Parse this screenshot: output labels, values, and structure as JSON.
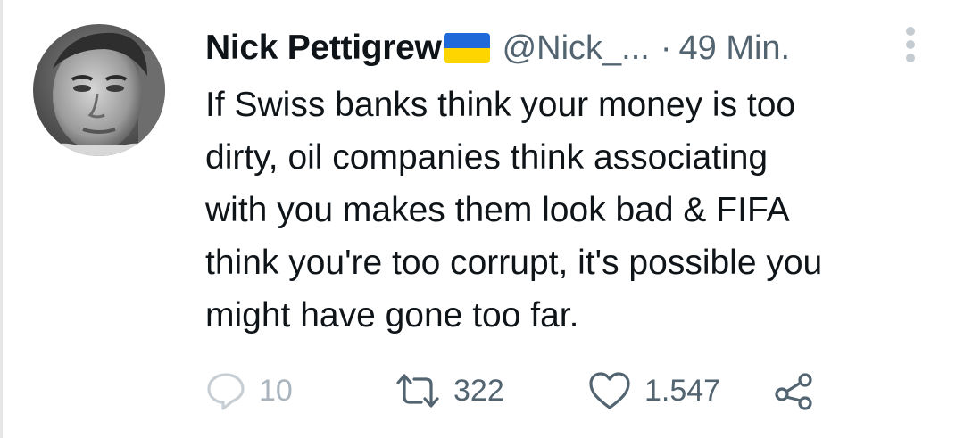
{
  "tweet": {
    "author_name": "Nick Pettigrew",
    "author_flag_icon": "ukraine-flag-icon",
    "handle": "@Nick_...",
    "separator": "·",
    "time": "49 Min.",
    "text_lines": [
      "If Swiss banks think your money is too",
      "dirty, oil companies think associating",
      "with you makes them look bad & FIFA",
      "think you're too corrupt, it's possible you",
      "might have gone too far."
    ]
  },
  "actions": {
    "reply_count": "10",
    "retweet_count": "322",
    "like_count": "1.547"
  },
  "colors": {
    "text": "#0f1419",
    "secondary": "#536471",
    "flag_blue": "#1f6ad8",
    "flag_yellow": "#ffd500"
  }
}
